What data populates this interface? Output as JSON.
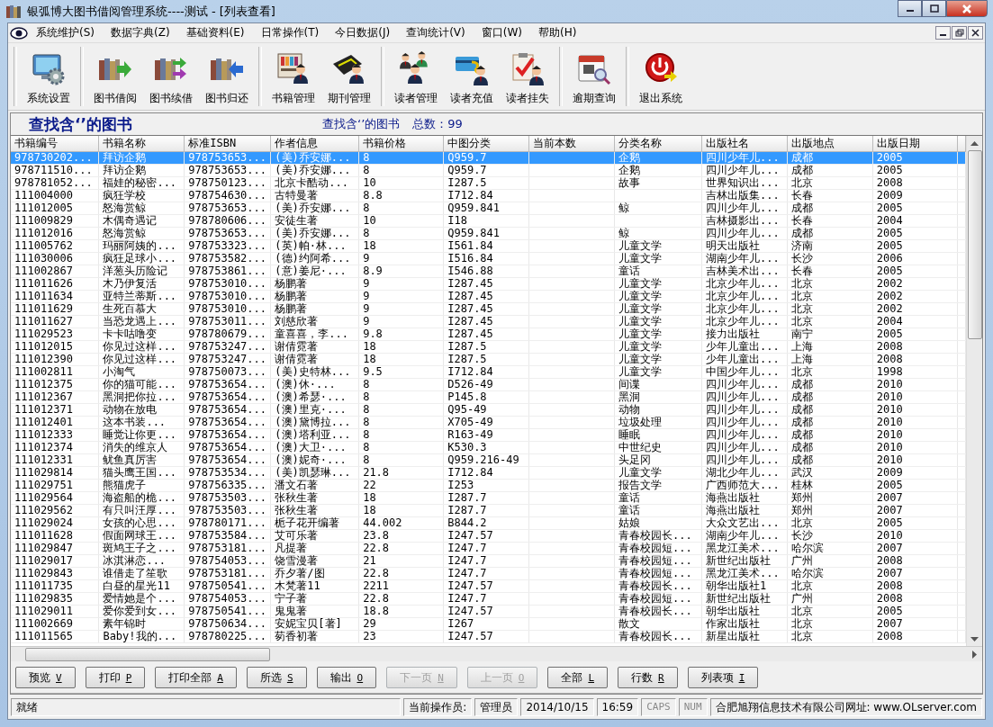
{
  "window": {
    "title": "银弧博大图书借阅管理系统----测试 - [列表查看]"
  },
  "menu": [
    "系统维护(S)",
    "数据字典(Z)",
    "基础资料(E)",
    "日常操作(T)",
    "今日数据(J)",
    "查询统计(V)",
    "窗口(W)",
    "帮助(H)"
  ],
  "toolbar": [
    "系统设置",
    "图书借阅",
    "图书续借",
    "图书归还",
    "书籍管理",
    "期刊管理",
    "读者管理",
    "读者充值",
    "读者挂失",
    "逾期查询",
    "退出系统"
  ],
  "panel": {
    "title": "查找含‘’的图书",
    "subtitle": "查找含‘’的图书",
    "total": "总数：99"
  },
  "table": {
    "columns": [
      "书籍编号",
      "书籍名称",
      "标准ISBN",
      "作者信息",
      "书籍价格",
      "中图分类",
      "当前本数",
      "分类名称",
      "出版社名",
      "出版地点",
      "出版日期"
    ],
    "rows": [
      {
        "selected": true,
        "cells": [
          "978730202...",
          "拜访企鹅",
          "978753653...",
          "(美)乔安娜...",
          "8",
          "Q959.7",
          null,
          "企鹅",
          "四川少年儿...",
          "成都",
          "2005"
        ]
      },
      {
        "selected": false,
        "cells": [
          "978711510...",
          "拜访企鹅",
          "978753653...",
          "(美)乔安娜...",
          "8",
          "Q959.7",
          null,
          "企鹅",
          "四川少年儿...",
          "成都",
          "2005"
        ]
      },
      {
        "selected": false,
        "cells": [
          "978781052...",
          "福娃的秘密...",
          "978750123...",
          "北京卡酷动...",
          "10",
          "I287.5",
          null,
          "故事",
          "世界知识出...",
          "北京",
          "2008"
        ]
      },
      {
        "selected": false,
        "cells": [
          "111004000",
          "疯狂学校",
          "978754630...",
          "古特曼著",
          "8.8",
          "I712.84",
          null,
          null,
          "吉林出版集...",
          "长春",
          "2009"
        ]
      },
      {
        "selected": false,
        "cells": [
          "111012005",
          "怒海赏鲸",
          "978753653...",
          "(美)乔安娜...",
          "8",
          "Q959.841",
          null,
          "鲸",
          "四川少年儿...",
          "成都",
          "2005"
        ]
      },
      {
        "selected": false,
        "cells": [
          "111009829",
          "木偶奇遇记",
          "978780606...",
          "安徒生著",
          "10",
          "I18",
          null,
          null,
          "吉林摄影出...",
          "长春",
          "2004"
        ]
      },
      {
        "selected": false,
        "cells": [
          "111012016",
          "怒海赏鲸",
          "978753653...",
          "(美)乔安娜...",
          "8",
          "Q959.841",
          null,
          "鲸",
          "四川少年儿...",
          "成都",
          "2005"
        ]
      },
      {
        "selected": false,
        "cells": [
          "111005762",
          "玛丽阿姨的...",
          "978753323...",
          "(英)帕·林...",
          "18",
          "I561.84",
          null,
          "儿童文学",
          "明天出版社",
          "济南",
          "2005"
        ]
      },
      {
        "selected": false,
        "cells": [
          "111030006",
          "疯狂足球小...",
          "978753582...",
          "(德)约阿希...",
          "9",
          "I516.84",
          null,
          "儿童文学",
          "湖南少年儿...",
          "长沙",
          "2006"
        ]
      },
      {
        "selected": false,
        "cells": [
          "111002867",
          "洋葱头历险记",
          "978753861...",
          "(意)姜尼·...",
          "8.9",
          "I546.88",
          null,
          "童话",
          "吉林美术出...",
          "长春",
          "2005"
        ]
      },
      {
        "selected": false,
        "cells": [
          "111011626",
          "木乃伊复活",
          "978753010...",
          "杨鹏著",
          "9",
          "I287.45",
          null,
          "儿童文学",
          "北京少年儿...",
          "北京",
          "2002"
        ]
      },
      {
        "selected": false,
        "cells": [
          "111011634",
          "亚特兰蒂斯...",
          "978753010...",
          "杨鹏著",
          "9",
          "I287.45",
          null,
          "儿童文学",
          "北京少年儿...",
          "北京",
          "2002"
        ]
      },
      {
        "selected": false,
        "cells": [
          "111011629",
          "生死百慕大",
          "978753010...",
          "杨鹏著",
          "9",
          "I287.45",
          null,
          "儿童文学",
          "北京少年儿...",
          "北京",
          "2002"
        ]
      },
      {
        "selected": false,
        "cells": [
          "111011627",
          "当恐龙遇上...",
          "978753011...",
          "刘慈欣著",
          "9",
          "I287.45",
          null,
          "儿童文学",
          "北京少年儿...",
          "北京",
          "2004"
        ]
      },
      {
        "selected": false,
        "cells": [
          "111029523",
          "卡卡咕噜变",
          "978780679...",
          "童喜喜，李...",
          "9.8",
          "I287.45",
          null,
          "儿童文学",
          "接力出版社",
          "南宁",
          "2005"
        ]
      },
      {
        "selected": false,
        "cells": [
          "111012015",
          "你见过这样...",
          "978753247...",
          "谢倩霓著",
          "18",
          "I287.5",
          null,
          "儿童文学",
          "少年儿童出...",
          "上海",
          "2008"
        ]
      },
      {
        "selected": false,
        "cells": [
          "111012390",
          "你见过这样...",
          "978753247...",
          "谢倩霓著",
          "18",
          "I287.5",
          null,
          "儿童文学",
          "少年儿童出...",
          "上海",
          "2008"
        ]
      },
      {
        "selected": false,
        "cells": [
          "111002811",
          "小淘气",
          "978750073...",
          "(美)史特林...",
          "9.5",
          "I712.84",
          null,
          "儿童文学",
          "中国少年儿...",
          "北京",
          "1998"
        ]
      },
      {
        "selected": false,
        "cells": [
          "111012375",
          "你的猫可能...",
          "978753654...",
          "(澳)休·...",
          "8",
          "D526-49",
          null,
          "间谍",
          "四川少年儿...",
          "成都",
          "2010"
        ]
      },
      {
        "selected": false,
        "cells": [
          "111012367",
          "黑洞把你拉...",
          "978753654...",
          "(澳)希瑟·...",
          "8",
          "P145.8",
          null,
          "黑洞",
          "四川少年儿...",
          "成都",
          "2010"
        ]
      },
      {
        "selected": false,
        "cells": [
          "111012371",
          "动物在放电",
          "978753654...",
          "(澳)里克·...",
          "8",
          "Q95-49",
          null,
          "动物",
          "四川少年儿...",
          "成都",
          "2010"
        ]
      },
      {
        "selected": false,
        "cells": [
          "111012401",
          "这本书装...",
          "978753654...",
          "(澳)黛博拉...",
          "8",
          "X705-49",
          null,
          "垃圾处理",
          "四川少年儿...",
          "成都",
          "2010"
        ]
      },
      {
        "selected": false,
        "cells": [
          "111012333",
          "睡觉让你更...",
          "978753654...",
          "(澳)塔利亚...",
          "8",
          "R163-49",
          null,
          "睡眠",
          "四川少年儿...",
          "成都",
          "2010"
        ]
      },
      {
        "selected": false,
        "cells": [
          "111012374",
          "消失的维京人",
          "978753654...",
          "(澳)大卫·...",
          "8",
          "K530.3",
          null,
          "中世纪史",
          "四川少年儿...",
          "成都",
          "2010"
        ]
      },
      {
        "selected": false,
        "cells": [
          "111012331",
          "鱿鱼真厉害",
          "978753654...",
          "(澳)妮奇·...",
          "8",
          "Q959.216-49",
          null,
          "头足冈",
          "四川少年儿...",
          "成都",
          "2010"
        ]
      },
      {
        "selected": false,
        "cells": [
          "111029814",
          "猫头鹰王国...",
          "978753534...",
          "(美)凯瑟琳...",
          "21.8",
          "I712.84",
          null,
          "儿童文学",
          "湖北少年儿...",
          "武汉",
          "2009"
        ]
      },
      {
        "selected": false,
        "cells": [
          "111029751",
          "熊猫虎子",
          "978756335...",
          "潘文石著",
          "22",
          "I253",
          null,
          "报告文学",
          "广西师范大...",
          "桂林",
          "2005"
        ]
      },
      {
        "selected": false,
        "cells": [
          "111029564",
          "海盗船的桅...",
          "978753503...",
          "张秋生著",
          "18",
          "I287.7",
          null,
          "童话",
          "海燕出版社",
          "郑州",
          "2007"
        ]
      },
      {
        "selected": false,
        "cells": [
          "111029562",
          "有只叫汪厚...",
          "978753503...",
          "张秋生著",
          "18",
          "I287.7",
          null,
          "童话",
          "海燕出版社",
          "郑州",
          "2007"
        ]
      },
      {
        "selected": false,
        "cells": [
          "111029024",
          "女孩的心思...",
          "978780171...",
          "栀子花开编著",
          "44.002",
          "B844.2",
          null,
          "姑娘",
          "大众文艺出...",
          "北京",
          "2005"
        ]
      },
      {
        "selected": false,
        "cells": [
          "111011628",
          "假面网球王...",
          "978753584...",
          "艾可乐著",
          "23.8",
          "I247.57",
          null,
          "青春校园长...",
          "湖南少年儿...",
          "长沙",
          "2010"
        ]
      },
      {
        "selected": false,
        "cells": [
          "111029847",
          "斑鸠王子之...",
          "978753181...",
          "凡提著",
          "22.8",
          "I247.7",
          null,
          "青春校园短...",
          "黑龙江美术...",
          "哈尔滨",
          "2007"
        ]
      },
      {
        "selected": false,
        "cells": [
          "111029017",
          "冰淇淋恋...",
          "978754053...",
          "饶雪漫著",
          "21",
          "I247.7",
          null,
          "青春校园短...",
          "新世纪出版社",
          "广州",
          "2008"
        ]
      },
      {
        "selected": false,
        "cells": [
          "111029843",
          "谁借走了笙歌",
          "978753181...",
          "乔夕著/图",
          "22.8",
          "I247.7",
          null,
          "青春校园短...",
          "黑龙江美术...",
          "哈尔滨",
          "2007"
        ]
      },
      {
        "selected": false,
        "cells": [
          "111011735",
          "白昼的星光11",
          "978750541...",
          "木梵著11",
          "2211",
          "I247.57",
          null,
          "青春校园长...",
          "朝华出版社1",
          "北京",
          "2008"
        ]
      },
      {
        "selected": false,
        "cells": [
          "111029835",
          "爱情她是个...",
          "978754053...",
          "宁子著",
          "22.8",
          "I247.7",
          null,
          "青春校园短...",
          "新世纪出版社",
          "广州",
          "2008"
        ]
      },
      {
        "selected": false,
        "cells": [
          "111029011",
          "爱你爱到女...",
          "978750541...",
          "鬼鬼著",
          "18.8",
          "I247.57",
          null,
          "青春校园长...",
          "朝华出版社",
          "北京",
          "2005"
        ]
      },
      {
        "selected": false,
        "cells": [
          "111002669",
          "素年锦时",
          "978750634...",
          "安妮宝贝[著]",
          "29",
          "I267",
          null,
          "散文",
          "作家出版社",
          "北京",
          "2007"
        ]
      },
      {
        "selected": false,
        "cells": [
          "111011565",
          "Baby!我的...",
          "978780225...",
          "茐香初著",
          "23",
          "I247.57",
          null,
          "青春校园长...",
          "新星出版社",
          "北京",
          "2008"
        ]
      }
    ]
  },
  "buttons": [
    {
      "label": "预览",
      "key": "V",
      "disabled": false
    },
    {
      "label": "打印",
      "key": "P",
      "disabled": false
    },
    {
      "label": "打印全部",
      "key": "A",
      "disabled": false
    },
    {
      "label": "所选",
      "key": "S",
      "disabled": false
    },
    {
      "label": "输出",
      "key": "O",
      "disabled": false
    },
    {
      "label": "下一页",
      "key": "N",
      "disabled": true
    },
    {
      "label": "上一页",
      "key": "O",
      "disabled": true
    },
    {
      "label": "全部",
      "key": "L",
      "disabled": false
    },
    {
      "label": "行数",
      "key": "R",
      "disabled": false
    },
    {
      "label": "列表项",
      "key": "I",
      "disabled": false
    }
  ],
  "status_bar": [
    {
      "text": "就绪",
      "kind": "message",
      "on": true
    },
    {
      "text": "当前操作员:",
      "kind": "label",
      "on": true
    },
    {
      "text": "管理员",
      "kind": "value",
      "on": true
    },
    {
      "text": "2014/10/15",
      "kind": "value",
      "on": true
    },
    {
      "text": "16:59",
      "kind": "value",
      "on": true
    },
    {
      "text": "CAPS",
      "kind": "indicator",
      "on": false
    },
    {
      "text": "NUM",
      "kind": "indicator",
      "on": false
    },
    {
      "text": "合肥旭翔信息技术有限公司网址: www.OLserver.com",
      "kind": "link",
      "on": true
    }
  ]
}
